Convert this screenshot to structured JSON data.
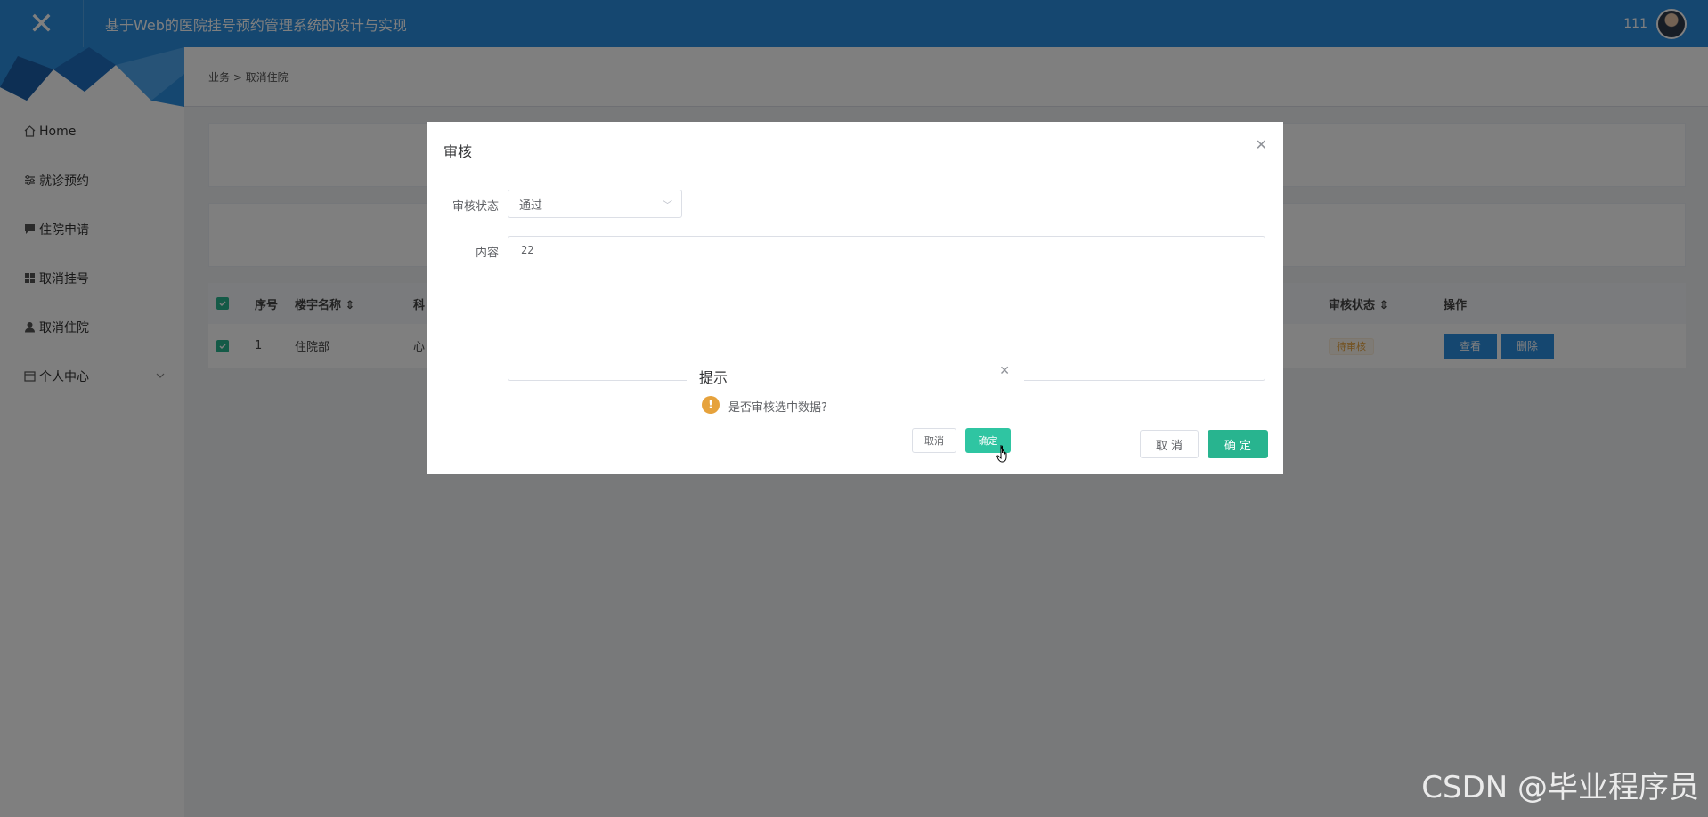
{
  "header": {
    "close_icon": "close-icon",
    "title": "基于Web的医院挂号预约管理系统的设计与实现",
    "username": "111",
    "brand_color": "#2b8ee0"
  },
  "sidebar": {
    "items": [
      {
        "label": "Home",
        "icon": "home-icon"
      },
      {
        "label": "就诊预约",
        "icon": "sliders-icon"
      },
      {
        "label": "住院申请",
        "icon": "comment-icon"
      },
      {
        "label": "取消挂号",
        "icon": "grid-icon"
      },
      {
        "label": "取消住院",
        "icon": "user-icon"
      },
      {
        "label": "个人中心",
        "icon": "calendar-icon"
      }
    ]
  },
  "breadcrumb": "业务 > 取消住院",
  "table": {
    "headers": {
      "index": "序号",
      "building": "楼宇名称",
      "dept_partial": "科",
      "status": "审核状态",
      "actions": "操作"
    },
    "rows": [
      {
        "index": "1",
        "building": "住院部",
        "dept_partial": "心",
        "status": "待审核",
        "view_label": "查看",
        "delete_label": "删除"
      }
    ]
  },
  "review_dialog": {
    "title": "审核",
    "status_label": "审核状态",
    "status_value": "通过",
    "content_label": "内容",
    "content_value": "22",
    "cancel_label": "取 消",
    "ok_label": "确 定"
  },
  "confirm": {
    "title": "提示",
    "message": "是否审核选中数据?",
    "cancel_label": "取消",
    "ok_label": "确定"
  },
  "watermark": "CSDN @毕业程序员",
  "colors": {
    "primary": "#2b8ee0",
    "success": "#28b48f",
    "confirm_ok": "#2fc5a2",
    "warning": "#e6a23c"
  }
}
